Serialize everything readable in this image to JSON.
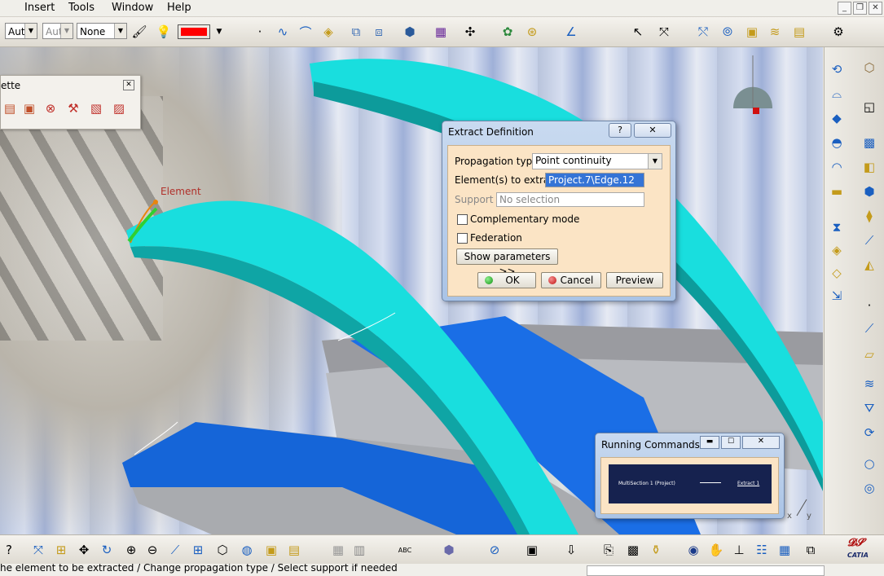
{
  "menu": {
    "insert": "Insert",
    "tools": "Tools",
    "window": "Window",
    "help": "Help"
  },
  "toolbar": {
    "combo1": "Aut",
    "combo2": "Aut",
    "combo3": "None",
    "color_swatch": "#ff0000"
  },
  "palette": {
    "title": "ette"
  },
  "element_label": "Element",
  "extract_dialog": {
    "title": "Extract Definition",
    "help": "?",
    "propagation_label": "Propagation type:",
    "propagation_value": "Point continuity",
    "elements_label": "Element(s) to extract",
    "elements_value": "Project.7\\Edge.12",
    "support_label": "Support :",
    "support_placeholder": "No selection",
    "complementary_label": "Complementary mode",
    "federation_label": "Federation",
    "show_params_label": "Show parameters >>",
    "ok_label": "OK",
    "cancel_label": "Cancel",
    "preview_label": "Preview"
  },
  "running_commands": {
    "title": "Running Commands",
    "cmd1": "MultiSection 1 (Project)",
    "cmd2": "Extract 1"
  },
  "status_text": "he element to be extracted / Change propagation type / Select support if needed",
  "brand": "CATIA",
  "colors": {
    "cyan": "#19dede",
    "blue": "#1a6ee6",
    "dialog_bg": "#fbe4c5",
    "title_bar": "#b8cde9"
  }
}
